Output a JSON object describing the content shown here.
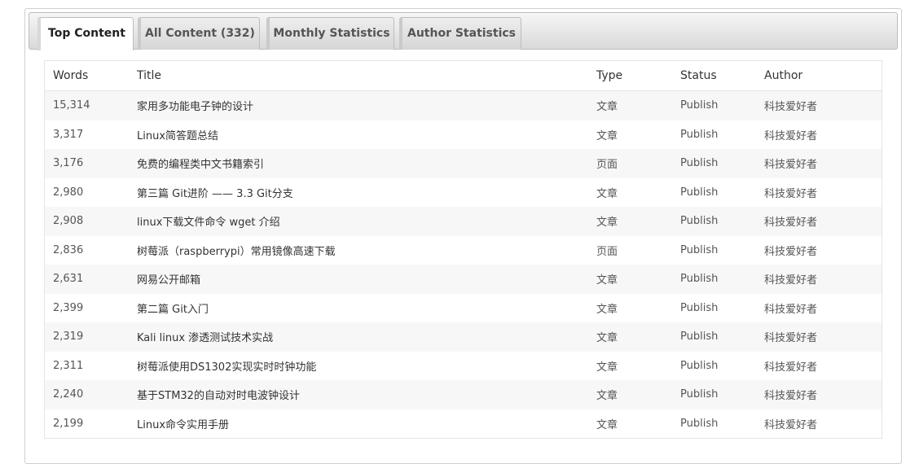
{
  "tabs": [
    {
      "label": "Top Content",
      "active": true
    },
    {
      "label": "All Content (332)",
      "active": false
    },
    {
      "label": "Monthly Statistics",
      "active": false
    },
    {
      "label": "Author Statistics",
      "active": false
    }
  ],
  "table": {
    "headers": {
      "words": "Words",
      "title": "Title",
      "type": "Type",
      "status": "Status",
      "author": "Author"
    },
    "rows": [
      {
        "words": "15,314",
        "title": "家用多功能电子钟的设计",
        "type": "文章",
        "status": "Publish",
        "author": "科技爱好者"
      },
      {
        "words": "3,317",
        "title": "Linux简答题总结",
        "type": "文章",
        "status": "Publish",
        "author": "科技爱好者"
      },
      {
        "words": "3,176",
        "title": "免费的编程类中文书籍索引",
        "type": "页面",
        "status": "Publish",
        "author": "科技爱好者"
      },
      {
        "words": "2,980",
        "title": "第三篇 Git进阶 —— 3.3 Git分支",
        "type": "文章",
        "status": "Publish",
        "author": "科技爱好者"
      },
      {
        "words": "2,908",
        "title": "linux下载文件命令 wget 介绍",
        "type": "文章",
        "status": "Publish",
        "author": "科技爱好者"
      },
      {
        "words": "2,836",
        "title": "树莓派（raspberrypi）常用镜像高速下载",
        "type": "页面",
        "status": "Publish",
        "author": "科技爱好者"
      },
      {
        "words": "2,631",
        "title": "网易公开邮箱",
        "type": "文章",
        "status": "Publish",
        "author": "科技爱好者"
      },
      {
        "words": "2,399",
        "title": "第二篇 Git入门",
        "type": "文章",
        "status": "Publish",
        "author": "科技爱好者"
      },
      {
        "words": "2,319",
        "title": "Kali linux 渗透测试技术实战",
        "type": "文章",
        "status": "Publish",
        "author": "科技爱好者"
      },
      {
        "words": "2,311",
        "title": "树莓派使用DS1302实现实时时钟功能",
        "type": "文章",
        "status": "Publish",
        "author": "科技爱好者"
      },
      {
        "words": "2,240",
        "title": "基于STM32的自动对时电波钟设计",
        "type": "文章",
        "status": "Publish",
        "author": "科技爱好者"
      },
      {
        "words": "2,199",
        "title": "Linux命令实用手册",
        "type": "文章",
        "status": "Publish",
        "author": "科技爱好者"
      }
    ]
  }
}
